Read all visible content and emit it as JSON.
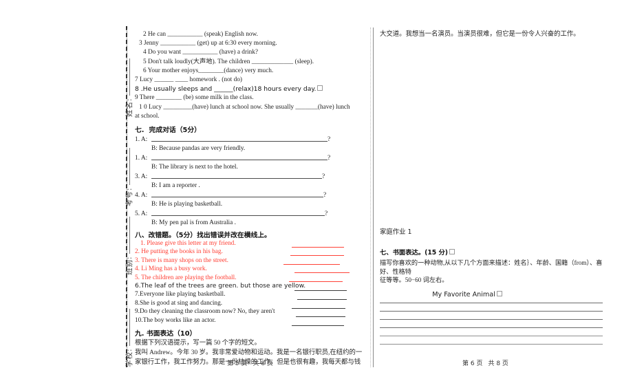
{
  "sidebar": {
    "labels": [
      "姓名:",
      "考号:",
      "班别:",
      "学校:"
    ]
  },
  "left_page": {
    "fill_in_blank_items": [
      "2   He can ___________ (speak) English now.",
      "3 Jenny ___________ (get) up at 6:30 every morning.",
      "4    Do you want ___________ (have) a drink?",
      "5   Don't talk loudly(大声地). The children _____________ (sleep).",
      "6   Your mother enjoys________(dance) very much.",
      "7 Lucy ______ ____ homework . (not do)",
      "8 .He usually sleeps and ______(relax)18 hours every day.",
      "9 There ________   (be) some milk in the class.",
      "1 0 Lucy _________(have) lunch at school now.   She usually _______(have) lunch",
      "at school."
    ],
    "section7": {
      "num": "七.",
      "title": "完成对话（5分）",
      "items": [
        {
          "label": "1. A:",
          "answer": "B: Because pandas are very friendly."
        },
        {
          "label": "1. A:",
          "answer": "B: The library is next to the hotel."
        },
        {
          "label": "3. A:",
          "answer": "B: I am a reporter ."
        },
        {
          "label": "4. A:",
          "answer": "B: He is playing basketball."
        },
        {
          "label": "5. A:",
          "answer": "B: My pen pal is from Australia ."
        }
      ],
      "question_mark": "?"
    },
    "section8": {
      "heading": "八、改错题。（5分）找出错误并改在横线上。",
      "items": [
        "1. Please   give   this   letter   at   my   friend.",
        "2. He   putting   the   books   in   his   bag.",
        "3. There   is   many   shops   on   the   street.",
        "4. Li Ming   has   a   busy   work.",
        "5. The   children   are   playing   the football.",
        "6.The leaf of the trees are green. but those are yellow.",
        "7.Everyone like playing basketball.",
        "8.She is good at sing and dancing.",
        "9.Do they cleaning the classroom now? No, they aren't",
        "10.The boy works like an actor."
      ]
    },
    "section9": {
      "heading": "九. 书面表达（10）",
      "prompt": "根据下列汉语提示，写一篇 50 个字的短文。",
      "body": [
        "我叫 Andrew。今年 30 岁。我非常爱动物和运动。我是一名银行职员,在纽约的一",
        "家银行工作，我工作努力。那是一份枯燥的工作。但是也很有趣，我每天都与钱"
      ]
    },
    "footer": {
      "page": "第 5 页",
      "total": "共 8 页"
    }
  },
  "right_page": {
    "continuation": "大交道。我想当一名演员。当演员很难，但它是一份令人兴奋的工作。",
    "homework_title": "家庭作业 1",
    "section7": {
      "heading": "七、书面表达。(15 分)",
      "prompt_line1": "描写你喜欢的一种动物,从以下几个方面来描述：姓名｝、年龄、国籍（from）、喜好、性格特",
      "prompt_line2": "征等等。50−60 词左右。",
      "composition_title": "My Favorite Animal",
      "line_count": 6
    },
    "footer": {
      "page": "第 6 页",
      "total": "共 8 页"
    }
  },
  "colors": {
    "red_text": "#ff3b30",
    "red_rule": "#ff4136",
    "black_rule": "#3a3a3a",
    "page_bg": "#ffffff"
  }
}
